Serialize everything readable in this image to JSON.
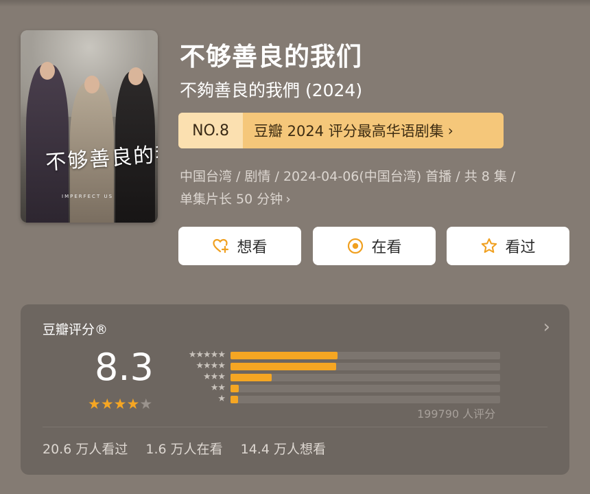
{
  "poster": {
    "title_art": "不够善良的我们",
    "subtitle_art": "IMPERFECT US"
  },
  "title": {
    "main": "不够善良的我们",
    "alt": "不夠善良的我們 (2024)"
  },
  "rank": {
    "number": "NO.8",
    "text": "豆瓣 2024 评分最高华语剧集",
    "chevron": "›"
  },
  "meta": {
    "line1": "中国台湾 / 剧情 / 2024-04-06(中国台湾) 首播 / 共 8 集 /",
    "line2": "单集片长 50 分钟",
    "chevron": "›"
  },
  "actions": {
    "want_label": "想看",
    "watching_label": "在看",
    "watched_label": "看过",
    "want_icon": "heart-plus-icon",
    "watching_icon": "target-icon",
    "watched_icon": "star-outline-icon"
  },
  "rating": {
    "title": "豆瓣评分®",
    "chevron": "›",
    "score": "8.3",
    "stars_filled": 4,
    "stars_total": 5,
    "distribution_percent": [
      39.6,
      39.3,
      15.3,
      3.0,
      2.8
    ],
    "count_text": "199790 人评分",
    "stats": {
      "watched": "20.6 万人看过",
      "watching": "1.6 万人在看",
      "want": "14.4 万人想看"
    }
  },
  "colors": {
    "background": "#847b73",
    "card": "#6d6660",
    "accent_orange": "#f5a623",
    "badge_light": "#fbe0b0",
    "badge_dark": "#f5c77a"
  }
}
